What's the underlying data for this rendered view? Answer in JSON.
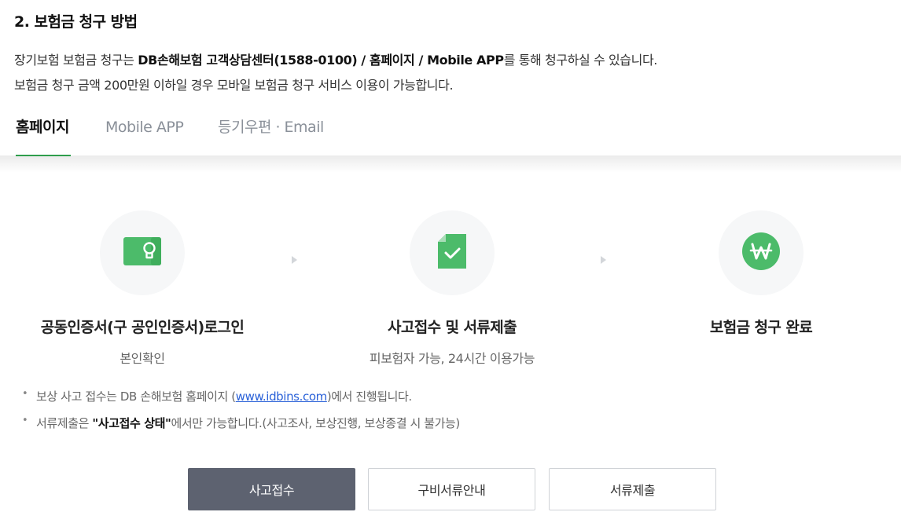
{
  "section": {
    "title": "2. 보험금 청구 방법",
    "desc_line1_pre": "장기보험 보험금 청구는 ",
    "desc_line1_bold": "DB손해보험 고객상담센터(1588-0100) / 홈페이지 / Mobile APP",
    "desc_line1_post": "를 통해 청구하실 수 있습니다.",
    "desc_line2": "보험금 청구 금액 200만원 이하일 경우 모바일 보험금 청구 서비스 이용이 가능합니다."
  },
  "tabs": [
    {
      "label": "홈페이지",
      "active": true
    },
    {
      "label": "Mobile APP",
      "active": false
    },
    {
      "label": "등기우편 · Email",
      "active": false
    }
  ],
  "steps": [
    {
      "icon": "certificate-icon",
      "title": "공동인증서(구 공인인증서)로그인",
      "subtitle": "본인확인"
    },
    {
      "icon": "document-check-icon",
      "title": "사고접수 및 서류제출",
      "subtitle": "피보험자 가능, 24시간 이용가능"
    },
    {
      "icon": "won-icon",
      "title": "보험금 청구 완료",
      "subtitle": ""
    }
  ],
  "notes": {
    "note1_pre": "보상 사고 접수는 DB 손해보험 홈페이지 (",
    "note1_link": "www.idbins.com",
    "note1_post": ")에서 진행됩니다.",
    "note2_pre": "서류제출은 ",
    "note2_bold": "\"사고접수 상태\"",
    "note2_post": "에서만 가능합니다.(사고조사, 보상진행, 보상종결 시 불가능)",
    "bullet": "•"
  },
  "buttons": {
    "accident_report": "사고접수",
    "required_documents": "구비서류안내",
    "submit_documents": "서류제출"
  },
  "colors": {
    "accent_green": "#2f9e4c",
    "icon_green": "#4cbb6a",
    "primary_button": "#5d6270",
    "link_blue": "#2a61d8"
  }
}
